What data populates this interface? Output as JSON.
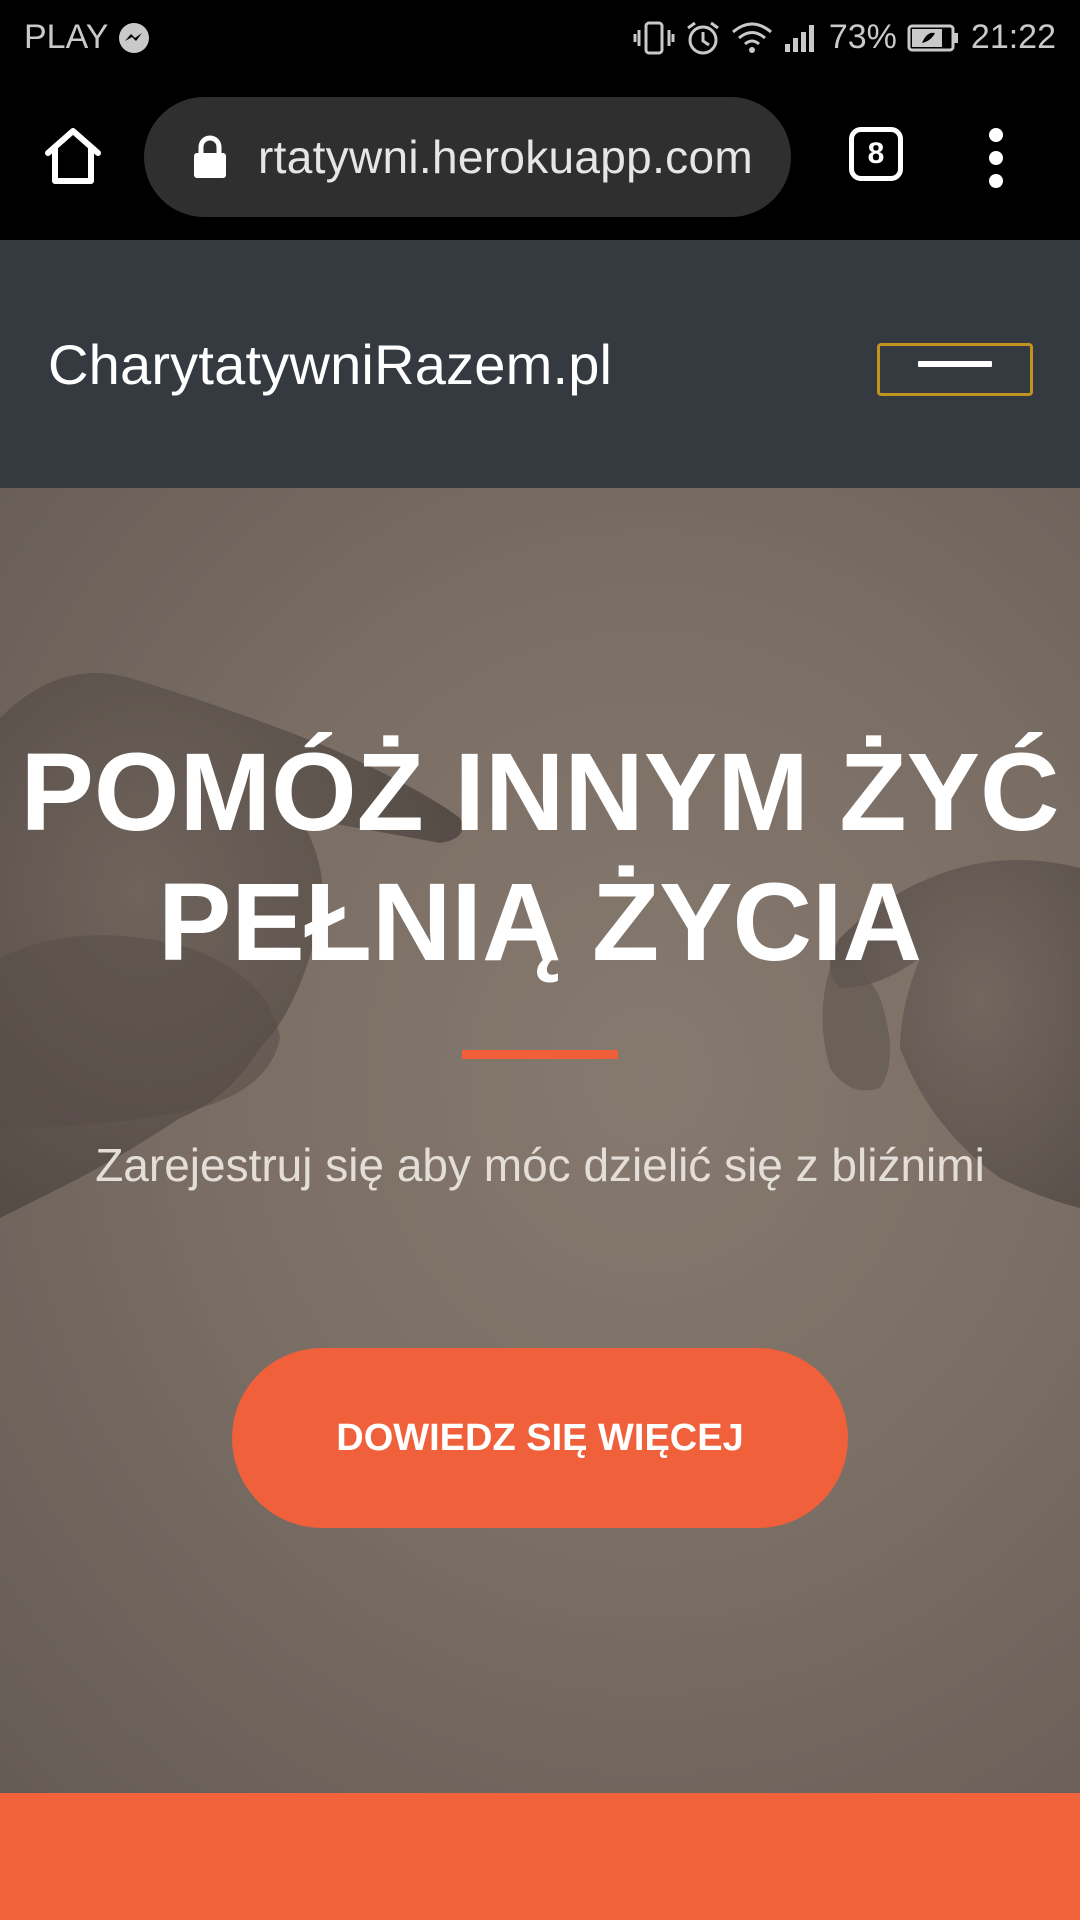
{
  "status_bar": {
    "carrier": "PLAY",
    "battery_percent": "73%",
    "time": "21:22",
    "icons": [
      "messenger-icon",
      "vibrate-icon",
      "alarm-icon",
      "wifi-icon",
      "signal-icon",
      "battery-icon"
    ]
  },
  "browser": {
    "url": "rtatywni.herokuapp.com",
    "tab_count": "8",
    "icons": [
      "home-icon",
      "lock-icon",
      "menu-dots-icon"
    ]
  },
  "navbar": {
    "brand": "CharytatywniRazem.pl",
    "toggle_border_color": "#c29320",
    "background_color": "#343a40"
  },
  "hero": {
    "title_line1": "POMÓŻ INNYM ŻYĆ",
    "title_line2": "PEŁNIĄ ŻYCIA",
    "subtitle": "Zarejestruj się aby móc dzielić się z bliźnimi",
    "cta_label": "DOWIEDZ SIĘ WIĘCEJ",
    "accent_color": "#f0603a"
  }
}
